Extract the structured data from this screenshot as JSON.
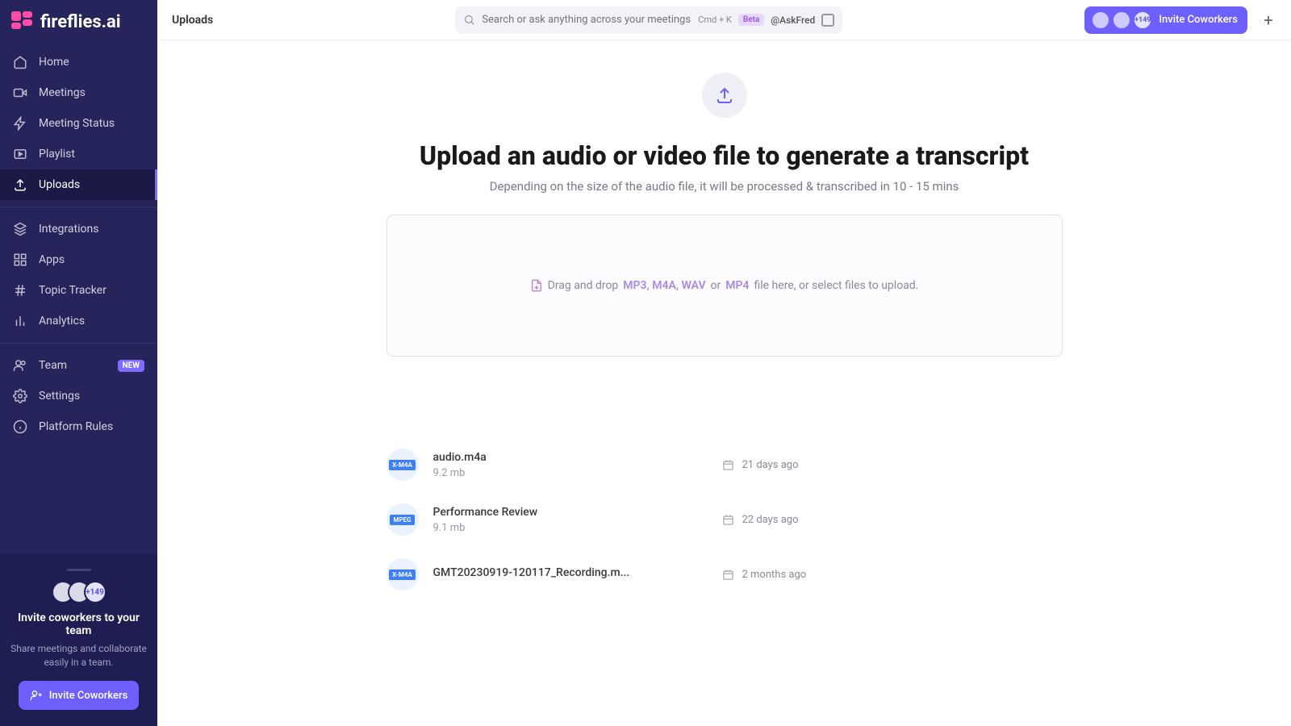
{
  "brand": "fireflies.ai",
  "page_title": "Uploads",
  "search": {
    "placeholder": "Search or ask anything across your meetings...",
    "shortcut": "Cmd + K",
    "beta_label": "Beta",
    "askfred": "@AskFred"
  },
  "top_invite": {
    "count_badge": "+149",
    "label": "Invite Coworkers"
  },
  "sidebar": {
    "items": [
      {
        "label": "Home",
        "icon": "home-icon"
      },
      {
        "label": "Meetings",
        "icon": "video-icon"
      },
      {
        "label": "Meeting Status",
        "icon": "bolt-icon"
      },
      {
        "label": "Playlist",
        "icon": "playlist-icon"
      },
      {
        "label": "Uploads",
        "icon": "upload-icon",
        "active": true
      }
    ],
    "items2": [
      {
        "label": "Integrations",
        "icon": "layers-icon"
      },
      {
        "label": "Apps",
        "icon": "grid-icon"
      },
      {
        "label": "Topic Tracker",
        "icon": "hash-icon"
      },
      {
        "label": "Analytics",
        "icon": "bars-icon"
      }
    ],
    "items3": [
      {
        "label": "Team",
        "icon": "team-icon",
        "badge": "NEW"
      },
      {
        "label": "Settings",
        "icon": "gear-icon"
      },
      {
        "label": "Platform Rules",
        "icon": "info-icon"
      }
    ],
    "invite_panel": {
      "count_badge": "+149",
      "title": "Invite coworkers to your team",
      "subtitle": "Share meetings and collaborate easily in a team.",
      "button": "Invite Coworkers"
    }
  },
  "hero": {
    "headline": "Upload an audio or video file to generate a transcript",
    "subline": "Depending on the size of the audio file, it will be processed & transcribed in 10 - 15 mins",
    "drop_pre": "Drag and drop",
    "drop_hl1": "MP3, M4A, WAV",
    "drop_mid": "or",
    "drop_hl2": "MP4",
    "drop_post": "file here, or select files to upload."
  },
  "files": [
    {
      "name": "audio.m4a",
      "size": "9.2 mb",
      "date": "21 days ago",
      "badge": "X-M4A"
    },
    {
      "name": "Performance Review",
      "size": "9.1 mb",
      "date": "22 days ago",
      "badge": "MPEG"
    },
    {
      "name": "GMT20230919-120117_Recording.m...",
      "size": "",
      "date": "2 months ago",
      "badge": "X-M4A"
    }
  ]
}
